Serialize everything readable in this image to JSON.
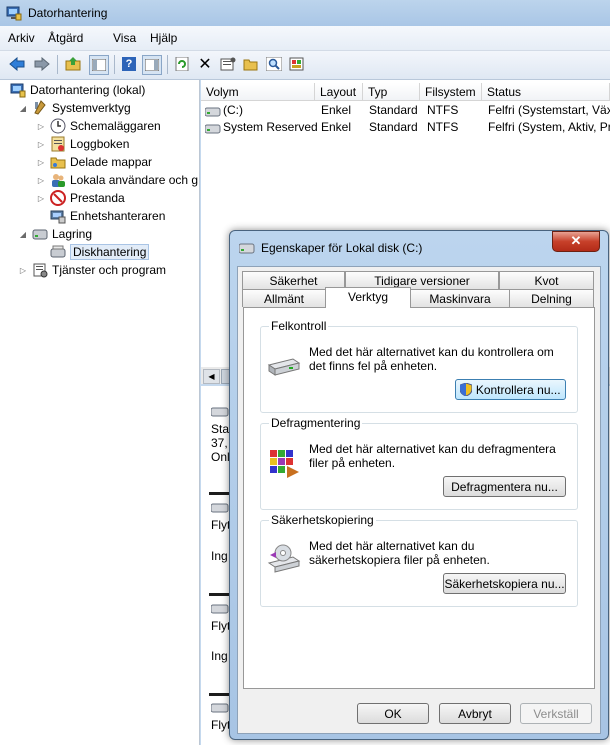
{
  "window": {
    "title": "Datorhantering"
  },
  "menu": [
    "Arkiv",
    "Åtgärd",
    "Visa",
    "Hjälp"
  ],
  "toolbar": [
    "back-icon",
    "forward-icon",
    "up-folder-icon",
    "show-tree-icon",
    "help-icon",
    "view-icon",
    "refresh-icon",
    "delete-icon",
    "properties-icon",
    "open-icon",
    "search-disk-icon",
    "wizard-icon"
  ],
  "tree": {
    "root": "Datorhantering (lokal)",
    "system_tools": "Systemverktyg",
    "items": [
      "Schemaläggaren",
      "Loggboken",
      "Delade mappar",
      "Lokala användare och g",
      "Prestanda",
      "Enhetshanteraren"
    ],
    "storage": "Lagring",
    "disk_mgmt": "Diskhantering",
    "services": "Tjänster och program"
  },
  "list": {
    "columns": [
      "Volym",
      "Layout",
      "Typ",
      "Filsystem",
      "Status"
    ],
    "rows": [
      [
        "(C:)",
        "Enkel",
        "Standard",
        "NTFS",
        "Felfri (Systemstart, Växl"
      ],
      [
        "System Reserved",
        "Enkel",
        "Standard",
        "NTFS",
        "Felfri (System, Aktiv, Pr"
      ]
    ]
  },
  "diskmap": {
    "disk0_line1": "Sta",
    "disk0_line2": "37,",
    "disk0_line3": "Onl",
    "disk1_line1": "Flyt",
    "disk1_line2": "Ing",
    "disk2_line1": "Flyt",
    "disk2_line2": "Ing",
    "disk3_line1": "Flyt"
  },
  "dialog": {
    "title": "Egenskaper för Lokal disk (C:)",
    "close": "✕",
    "tabs_back": [
      "Säkerhet",
      "Tidigare versioner",
      "Kvot"
    ],
    "tabs_front": [
      "Allmänt",
      "Verktyg",
      "Maskinvara",
      "Delning"
    ],
    "groups": [
      {
        "title": "Felkontroll",
        "text": "Med det här alternativet kan du kontrollera om det finns fel på enheten.",
        "button": "Kontrollera nu..."
      },
      {
        "title": "Defragmentering",
        "text": "Med det här alternativet kan du defragmentera filer på enheten.",
        "button": "Defragmentera nu..."
      },
      {
        "title": "Säkerhetskopiering",
        "text": "Med det här alternativet kan du säkerhetskopiera filer på enheten.",
        "button": "Säkerhetskopiera nu..."
      }
    ],
    "ok": "OK",
    "cancel": "Avbryt",
    "apply": "Verkställ"
  }
}
